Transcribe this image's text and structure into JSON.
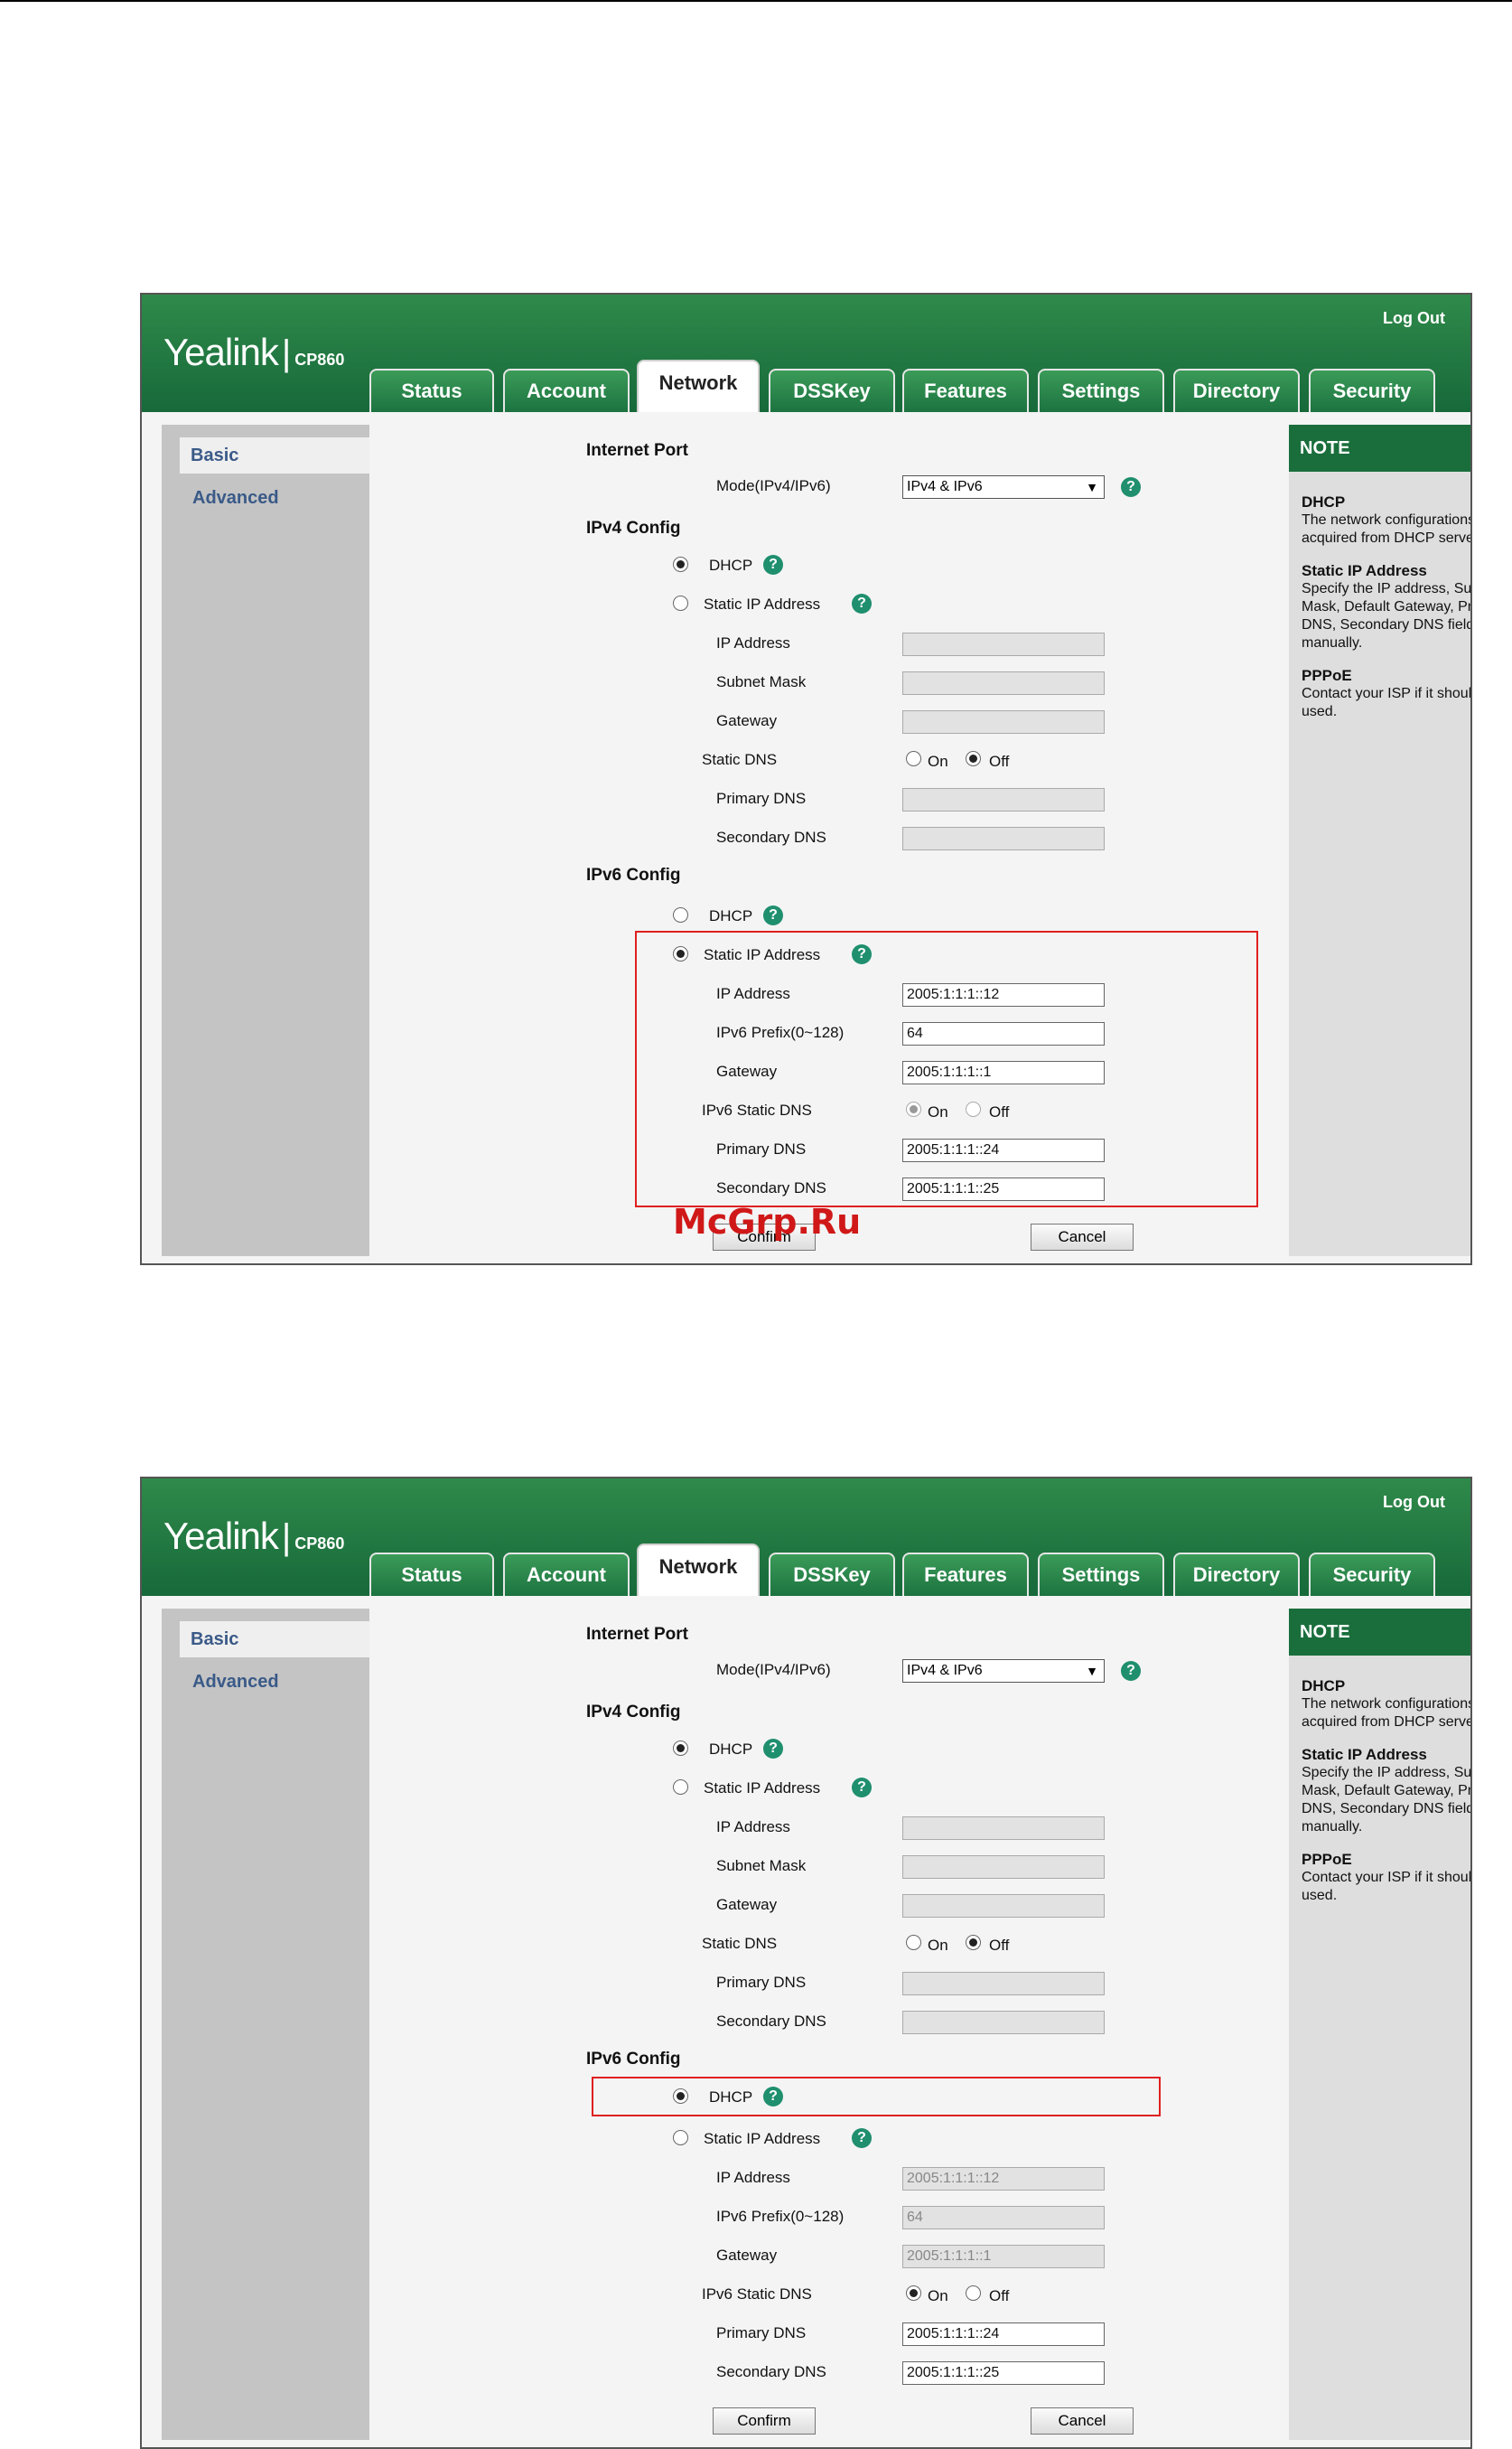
{
  "header": {
    "logout": "Log Out",
    "brand": "Yealink",
    "separator": "|",
    "model": "CP860"
  },
  "tabs": [
    "Status",
    "Account",
    "Network",
    "DSSKey",
    "Features",
    "Settings",
    "Directory",
    "Security"
  ],
  "sidebar": {
    "basic": "Basic",
    "advanced": "Advanced"
  },
  "form": {
    "internet_port": "Internet Port",
    "mode_label": "Mode(IPv4/IPv6)",
    "mode_value": "IPv4 & IPv6",
    "ipv4_config": "IPv4 Config",
    "ipv6_config": "IPv6 Config",
    "dhcp": "DHCP",
    "static_ip": "Static IP Address",
    "ip_address": "IP Address",
    "subnet_mask": "Subnet Mask",
    "gateway": "Gateway",
    "static_dns": "Static DNS",
    "on": "On",
    "off": "Off",
    "primary_dns": "Primary DNS",
    "secondary_dns": "Secondary DNS",
    "ipv6_prefix": "IPv6 Prefix(0~128)",
    "ipv6_static_dns": "IPv6 Static DNS",
    "confirm": "Confirm",
    "cancel": "Cancel",
    "help_glyph": "?"
  },
  "ipv6_values": {
    "ip": "2005:1:1:1::12",
    "prefix": "64",
    "gateway": "2005:1:1:1::1",
    "primary_dns": "2005:1:1:1::24",
    "secondary_dns": "2005:1:1:1::25"
  },
  "note": {
    "title": "NOTE",
    "dhcp_title": "DHCP",
    "dhcp_text": "The network configurations will be acquired from DHCP server.",
    "static_title": "Static IP Address",
    "static_text": "Specify the IP address, Subnet Mask, Default Gateway, Primary DNS, Secondary DNS fields manually.",
    "pppoe_title": "PPPoE",
    "pppoe_text": "Contact your ISP if it should be used."
  },
  "watermark": "McGrp.Ru",
  "colors": {
    "header_green": "#1c7340",
    "note_orange": "#ef7d1e",
    "highlight_red": "#e02020",
    "help_teal": "#1f8f6e"
  }
}
